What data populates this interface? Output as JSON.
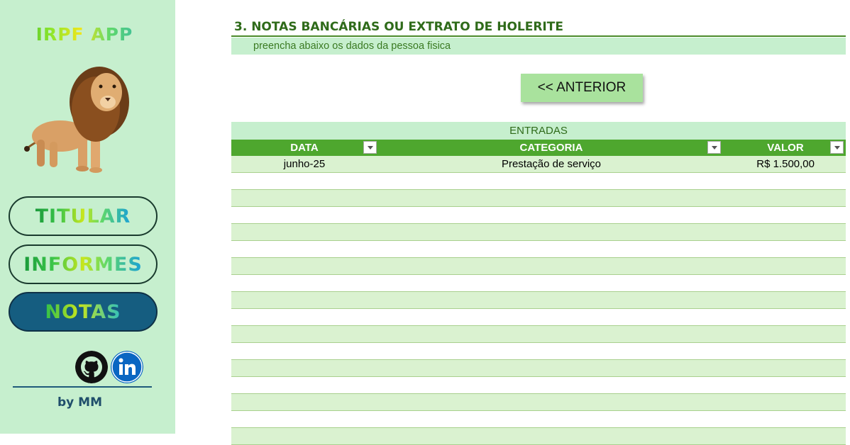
{
  "sidebar": {
    "app_title": "IRPF APP",
    "logo_icon": "lion-icon",
    "nav": {
      "titular": "TITULAR",
      "informes": "INFORMES",
      "notas": "NOTAS"
    },
    "active_item": "NOTAS",
    "social_icons": [
      "github-icon",
      "linkedin-icon"
    ],
    "byline": "by MM"
  },
  "header": {
    "title": "3. NOTAS BANCÁRIAS OU EXTRATO DE HOLERITE",
    "subtitle": "preencha abaixo os dados da pessoa fisica"
  },
  "actions": {
    "previous_label": "<< ANTERIOR"
  },
  "table": {
    "caption": "ENTRADAS",
    "columns": [
      "DATA",
      "CATEGORIA",
      "VALOR"
    ],
    "rows": [
      [
        "junho-25",
        "Prestação de serviço",
        "R$ 1.500,00"
      ]
    ],
    "empty_rows": 16
  },
  "colors": {
    "sidebar_bg": "#c6efce",
    "header_green": "#4ea72e",
    "row_alt": "#daf2d0",
    "active_nav": "#155d80",
    "button_green": "#a9e29d"
  }
}
